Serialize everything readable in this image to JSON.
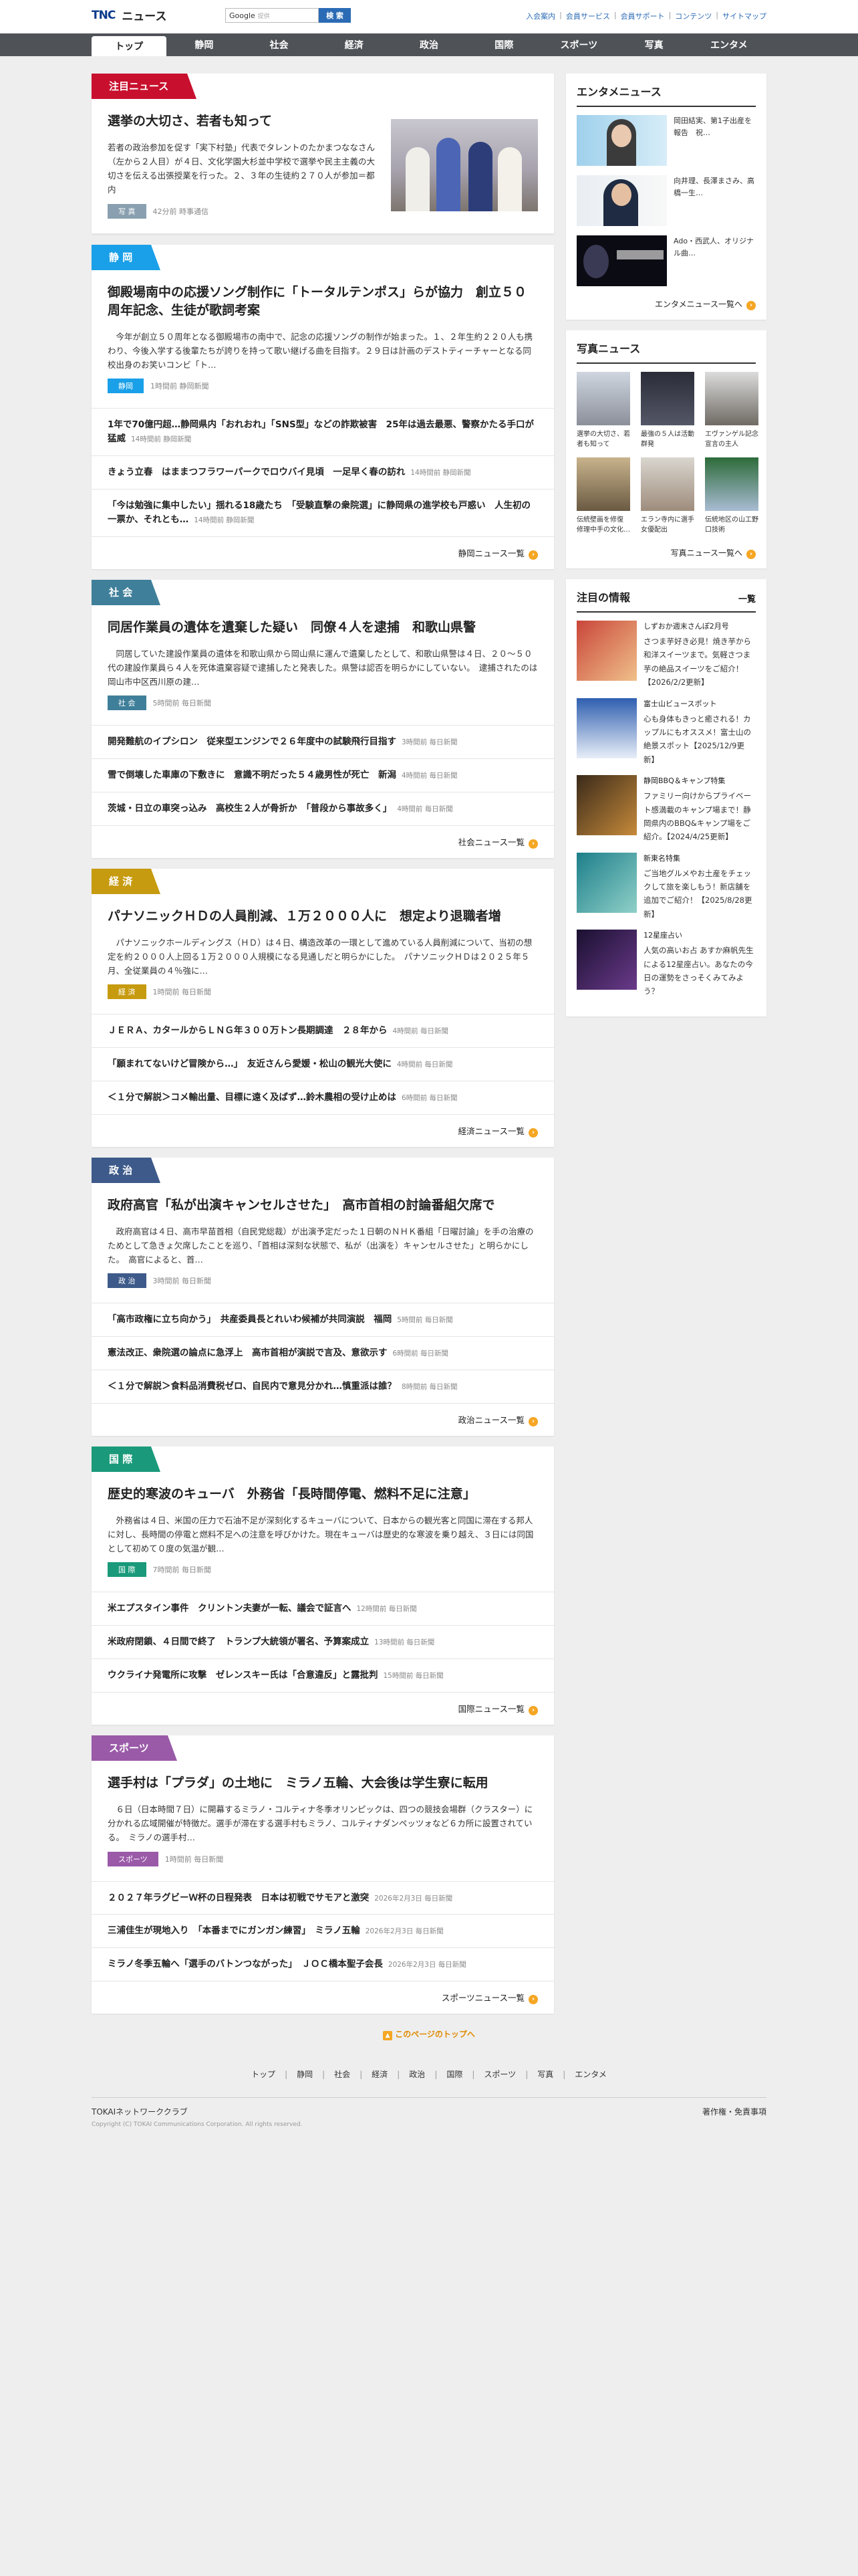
{
  "header": {
    "logo": "TNC",
    "site_name": "ニュース",
    "search_label": "Google",
    "search_placeholder": "提供",
    "search_button": "検 索",
    "links": [
      "入会案内",
      "会員サービス",
      "会員サポート",
      "コンテンツ",
      "サイトマップ"
    ]
  },
  "nav": [
    "トップ",
    "静岡",
    "社会",
    "経済",
    "政治",
    "国際",
    "スポーツ",
    "写真",
    "エンタメ"
  ],
  "sections": [
    {
      "tab": "注目ニュース",
      "color": "#c8102e",
      "lead": {
        "title": "選挙の大切さ、若者も知って",
        "body": "若者の政治参加を促す「実下村塾」代表でタレントのたかまつななさん（左から２人目）が４日、文化学園大杉並中学校で選挙や民主主義の大切さを伝える出張授業を行った。２、３年の生徒約２７０人が参加＝都内",
        "cat": "写 真",
        "cat_color": "#8aa0b0",
        "meta": "42分前 時事通信"
      },
      "items": [],
      "more": ""
    },
    {
      "tab": "静 岡",
      "color": "#1aa0e8",
      "lead": {
        "title": "御殿場南中の応援ソング制作に「トータルテンポス」らが協力　創立５０周年記念、生徒が歌詞考案",
        "body": "　今年が創立５０周年となる御殿場市の南中で、記念の応援ソングの制作が始まった。１、２年生約２２０人も携わり、今後入学する後輩たちが誇りを持って歌い継げる曲を目指す。２９日は計画のデストティーチャーとなる同校出身のお笑いコンビ「ト…",
        "cat": "静岡",
        "cat_color": "#1aa0e8",
        "meta": "1時間前 静岡新聞"
      },
      "items": [
        {
          "t": "1年で70億円超…静岡県内「おれおれ」「SNS型」などの詐欺被害　25年は過去最悪、警察かたる手口が猛威",
          "m": "14時間前 静岡新聞"
        },
        {
          "t": "きょう立春　はままつフラワーパークでロウバイ見頃　一足早く春の訪れ",
          "m": "14時間前 静岡新聞"
        },
        {
          "t": "「今は勉強に集中したい」揺れる18歳たち　「受験直撃の衆院選」に静岡県の進学校も戸惑い　人生初の一票か、それとも…",
          "m": "14時間前 静岡新聞"
        }
      ],
      "more": "静岡ニュース一覧"
    },
    {
      "tab": "社 会",
      "color": "#3f7f9a",
      "lead": {
        "title": "同居作業員の遺体を遺棄した疑い　同僚４人を逮捕　和歌山県警",
        "body": "　同居していた建設作業員の遺体を和歌山県から岡山県に運んで遺棄したとして、和歌山県警は４日、２０～５０代の建設作業員ら４人を死体遺棄容疑で逮捕したと発表した。県警は認否を明らかにしていない。　逮捕されたのは岡山市中区西川原の建…",
        "cat": "社 会",
        "cat_color": "#3f7f9a",
        "meta": "5時間前 毎日新聞"
      },
      "items": [
        {
          "t": "開発難航のイプシロン　従来型エンジンで２６年度中の試験飛行目指す",
          "m": "3時間前 毎日新聞"
        },
        {
          "t": "雪で倒壊した車庫の下敷きに　意識不明だった５４歳男性が死亡　新潟",
          "m": "4時間前 毎日新聞"
        },
        {
          "t": "茨城・日立の車突っ込み　高校生２人が骨折か　「普段から事故多く」",
          "m": "4時間前 毎日新聞"
        }
      ],
      "more": "社会ニュース一覧"
    },
    {
      "tab": "経 済",
      "color": "#c79b10",
      "lead": {
        "title": "パナソニックＨＤの人員削減、１万２０００人に　想定より退職者増",
        "body": "　パナソニックホールディングス（ＨＤ）は４日、構造改革の一環として進めている人員削減について、当初の想定を約２０００人上回る１万２０００人規模になる見通しだと明らかにした。　パナソニックＨＤは２０２５年５月、全従業員の４％強に…",
        "cat": "経 済",
        "cat_color": "#c79b10",
        "meta": "1時間前 毎日新聞"
      },
      "items": [
        {
          "t": "ＪＥＲＡ、カタールからＬＮＧ年３００万トン長期調達　２８年から",
          "m": "4時間前 毎日新聞"
        },
        {
          "t": "「願まれてないけど冒険から…」　友近さんら愛媛・松山の観光大使に",
          "m": "4時間前 毎日新聞"
        },
        {
          "t": "＜１分で解説＞コメ輸出量、目標に遠く及ばず…鈴木農相の受け止めは",
          "m": "6時間前 毎日新聞"
        }
      ],
      "more": "経済ニュース一覧"
    },
    {
      "tab": "政 治",
      "color": "#3d5a8a",
      "lead": {
        "title": "政府高官「私が出演キャンセルさせた」　高市首相の討論番組欠席で",
        "body": "　政府高官は４日、高市早苗首相（自民党総裁）が出演予定だった１日朝のＮＨＫ番組「日曜討論」を手の治療のためとして急きょ欠席したことを巡り、「首相は深刻な状態で、私が（出演を）キャンセルさせた」と明らかにした。　高官によると、首…",
        "cat": "政 治",
        "cat_color": "#3d5a8a",
        "meta": "3時間前 毎日新聞"
      },
      "items": [
        {
          "t": "「高市政権に立ち向かう」　共産委員長とれいわ候補が共同演説　福岡",
          "m": "5時間前 毎日新聞"
        },
        {
          "t": "憲法改正、衆院選の論点に急浮上　高市首相が演説で言及、意欲示す",
          "m": "6時間前 毎日新聞"
        },
        {
          "t": "＜１分で解説＞食料品消費税ゼロ、自民内で意見分かれ…慎重派は誰？",
          "m": "8時間前 毎日新聞"
        }
      ],
      "more": "政治ニュース一覧"
    },
    {
      "tab": "国 際",
      "color": "#1a9a7a",
      "lead": {
        "title": "歴史的寒波のキューバ　外務省「長時間停電、燃料不足に注意」",
        "body": "　外務省は４日、米国の圧力で石油不足が深刻化するキューバについて、日本からの観光客と同国に滞在する邦人に対し、長時間の停電と燃料不足への注意を呼びかけた。現在キューバは歴史的な寒波を乗り越え、３日には同国として初めて０度の気温が観…",
        "cat": "国 際",
        "cat_color": "#1a9a7a",
        "meta": "7時間前 毎日新聞"
      },
      "items": [
        {
          "t": "米エプスタイン事件　クリントン夫妻が一転、議会で証言へ",
          "m": "12時間前 毎日新聞"
        },
        {
          "t": "米政府閉鎖、４日間で終了　トランプ大統領が署名、予算案成立",
          "m": "13時間前 毎日新聞"
        },
        {
          "t": "ウクライナ発電所に攻撃　ゼレンスキー氏は「合意違反」と露批判",
          "m": "15時間前 毎日新聞"
        }
      ],
      "more": "国際ニュース一覧"
    },
    {
      "tab": "スポーツ",
      "color": "#9a5aa8",
      "lead": {
        "title": "選手村は「プラダ」の土地に　ミラノ五輪、大会後は学生寮に転用",
        "body": "　６日（日本時間７日）に開幕するミラノ・コルティナ冬季オリンピックは、四つの競技会場群（クラスター）に分かれる広域開催が特徴だ。選手が滞在する選手村もミラノ、コルティナダンペッツォなど６カ所に設置されている。　ミラノの選手村…",
        "cat": "スポーツ",
        "cat_color": "#9a5aa8",
        "meta": "1時間前 毎日新聞"
      },
      "items": [
        {
          "t": "２０２７年ラグビーＷ杯の日程発表　日本は初戦でサモアと激突",
          "m": "2026年2月3日 毎日新聞"
        },
        {
          "t": "三浦佳生が現地入り　「本番までにガンガン練習」　ミラノ五輪",
          "m": "2026年2月3日 毎日新聞"
        },
        {
          "t": "ミラノ冬季五輪へ「選手のバトンつながった」　ＪＯＣ橋本聖子会長",
          "m": "2026年2月3日 毎日新聞"
        }
      ],
      "more": "スポーツニュース一覧"
    }
  ],
  "sidebar": {
    "ent": {
      "title": "エンタメニュース",
      "items": [
        "岡田結実、第1子出産を報告　祝…",
        "向井理、長澤まさみ、高橋一生…",
        "Ado・西武人、オリジナル曲…"
      ],
      "more": "エンタメニュース一覧へ"
    },
    "photo": {
      "title": "写真ニュース",
      "items": [
        "選挙の大切さ、若者も知って",
        "最強の５人は活動群発",
        "エヴァンゲル記念宣言の主人",
        "伝統壁画を修復 修理中手の文化…",
        "エラン寺内に選手女優配出",
        "伝統地区の山工野口技術"
      ],
      "more": "写真ニュース一覧へ"
    },
    "info": {
      "title": "注目の情報",
      "list_label": "一覧",
      "items": [
        {
          "b": "しずおか週末さんぽ2月号",
          "s": "さつま芋好き必見！焼き芋から和洋スイーツまで。気軽さつま芋の絶品スイーツをご紹介！【2026/2/2更新】"
        },
        {
          "b": "富士山ビュースポット",
          "s": "心も身体もきっと癒される！カップルにもオススメ！富士山の絶景スポット【2025/12/9更新】"
        },
        {
          "b": "静岡BBQ＆キャンプ特集",
          "s": "ファミリー向けからプライベート感満載のキャンプ場まで！静岡県内のBBQ&キャンプ場をご紹介。【2024/4/25更新】"
        },
        {
          "b": "新東名特集",
          "s": "ご当地グルメやお土産をチェックして旅を楽しもう！新店舗を追加でご紹介！【2025/8/28更新】"
        },
        {
          "b": "12星座占い",
          "s": "人気の高いお占 あすか麻帆先生による12星座占い。あなたの今日の運勢をさっそくみてみよう？"
        }
      ]
    }
  },
  "footer": {
    "pagetop": "このページのトップへ",
    "nav": [
      "トップ",
      "静岡",
      "社会",
      "経済",
      "政治",
      "国際",
      "スポーツ",
      "写真",
      "エンタメ"
    ],
    "brand": "TOKAIネットワーククラブ",
    "copyright": "Copyright (C) TOKAI Communications Corporation. All rights reserved.",
    "right": "著作権・免責事項"
  }
}
